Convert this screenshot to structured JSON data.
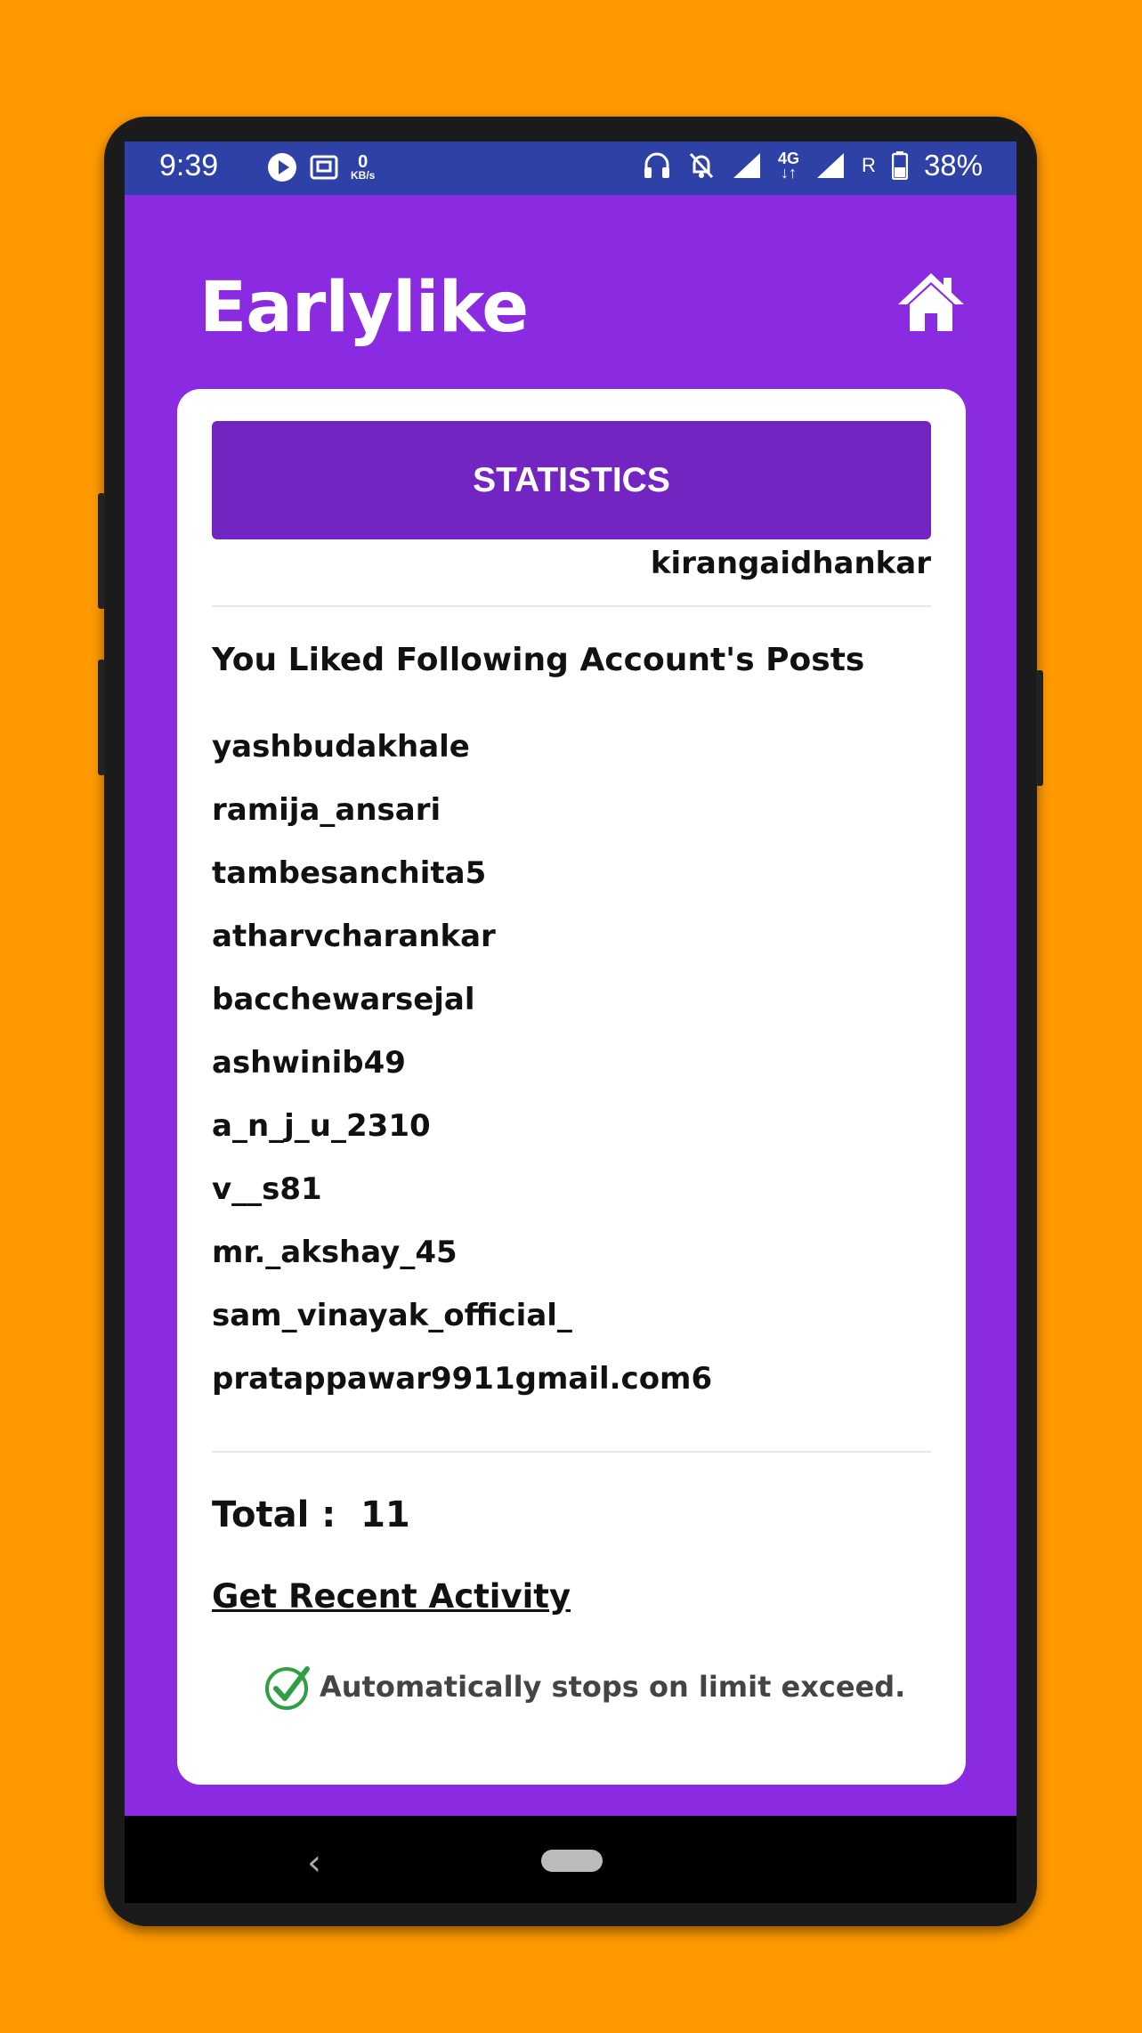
{
  "status_bar": {
    "time": "9:39",
    "net_speed_value": "0",
    "net_speed_unit": "KB/s",
    "network_label": "4G",
    "roaming_label": "R",
    "battery": "38%"
  },
  "header": {
    "app_title": "Earlylike",
    "home_icon": "home-icon"
  },
  "card": {
    "stats_button": "STATISTICS",
    "username": "kirangaidhankar",
    "section_heading": "You Liked Following Account's Posts",
    "accounts": [
      "yashbudakhale",
      "ramija_ansari",
      "tambesanchita5",
      "atharvcharankar",
      "bacchewarsejal",
      "ashwinib49",
      "a_n_j_u_2310",
      "v__s81",
      "mr._akshay_45",
      "sam_vinayak_official_",
      "pratappawar9911gmail.com6"
    ],
    "total_label": "Total :",
    "total_value": "11",
    "recent_link": "Get Recent Activity",
    "notice": "Automatically stops on limit exceed."
  },
  "nav_bar": {
    "back_glyph": "‹"
  },
  "colors": {
    "background": "#FF9900",
    "app_purple": "#8A2BE2",
    "button_purple": "#7325C2",
    "status_bar": "#2E41A6",
    "check_green": "#2EA043"
  }
}
